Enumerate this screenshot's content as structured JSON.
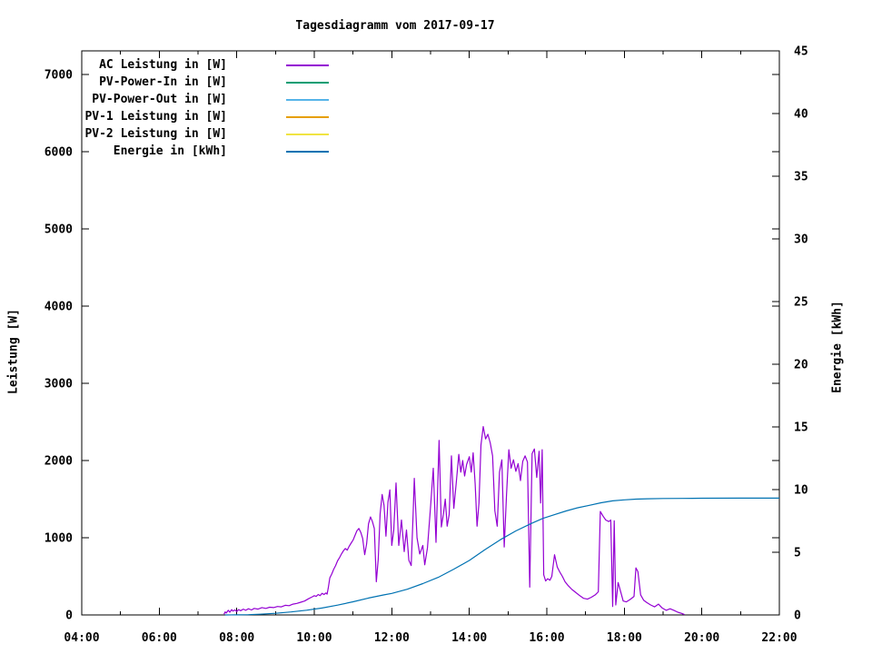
{
  "chart_data": {
    "type": "line",
    "title": "Tagesdiagramm vom 2017-09-17",
    "background_color": "#ffffff",
    "axis_color": "#000000",
    "grid": false,
    "legend_position": "top-left-inside",
    "x_axis": {
      "unit": "time-of-day",
      "range_hours": [
        4,
        22
      ],
      "tick_hours": [
        4,
        6,
        8,
        10,
        12,
        14,
        16,
        18,
        20,
        22
      ],
      "tick_labels": [
        "04:00",
        "06:00",
        "08:00",
        "10:00",
        "12:00",
        "14:00",
        "16:00",
        "18:00",
        "20:00",
        "22:00"
      ],
      "minor_tick_hours": [
        5,
        7,
        9,
        11,
        13,
        15,
        17,
        19,
        21
      ]
    },
    "y_left_axis": {
      "label": "Leistung [W]",
      "range": [
        0,
        7306
      ],
      "ticks": [
        0,
        1000,
        2000,
        3000,
        4000,
        5000,
        6000,
        7000
      ]
    },
    "y_right_axis": {
      "label": "Energie [kWh]",
      "range": [
        0,
        45
      ],
      "ticks": [
        0,
        5,
        10,
        15,
        20,
        25,
        30,
        35,
        40,
        45
      ]
    },
    "series": [
      {
        "name": "AC Leistung in [W]",
        "color": "#9400d3",
        "axis": "left",
        "points": [
          [
            7.67,
            10
          ],
          [
            7.7,
            40
          ],
          [
            7.73,
            25
          ],
          [
            7.78,
            60
          ],
          [
            7.82,
            35
          ],
          [
            7.87,
            70
          ],
          [
            7.9,
            50
          ],
          [
            7.95,
            65
          ],
          [
            8.0,
            45
          ],
          [
            8.05,
            70
          ],
          [
            8.1,
            55
          ],
          [
            8.17,
            75
          ],
          [
            8.23,
            60
          ],
          [
            8.3,
            80
          ],
          [
            8.38,
            65
          ],
          [
            8.45,
            85
          ],
          [
            8.55,
            75
          ],
          [
            8.65,
            95
          ],
          [
            8.75,
            85
          ],
          [
            8.85,
            100
          ],
          [
            8.95,
            95
          ],
          [
            9.05,
            110
          ],
          [
            9.15,
            105
          ],
          [
            9.25,
            125
          ],
          [
            9.35,
            120
          ],
          [
            9.45,
            140
          ],
          [
            9.55,
            150
          ],
          [
            9.65,
            165
          ],
          [
            9.75,
            180
          ],
          [
            9.85,
            210
          ],
          [
            9.95,
            235
          ],
          [
            10.0,
            250
          ],
          [
            10.05,
            240
          ],
          [
            10.1,
            265
          ],
          [
            10.15,
            250
          ],
          [
            10.2,
            280
          ],
          [
            10.25,
            265
          ],
          [
            10.3,
            285
          ],
          [
            10.33,
            270
          ],
          [
            10.36,
            350
          ],
          [
            10.4,
            480
          ],
          [
            10.45,
            530
          ],
          [
            10.5,
            590
          ],
          [
            10.55,
            640
          ],
          [
            10.6,
            700
          ],
          [
            10.65,
            740
          ],
          [
            10.7,
            790
          ],
          [
            10.75,
            830
          ],
          [
            10.8,
            860
          ],
          [
            10.85,
            840
          ],
          [
            10.9,
            890
          ],
          [
            10.95,
            930
          ],
          [
            11.0,
            970
          ],
          [
            11.05,
            1030
          ],
          [
            11.1,
            1090
          ],
          [
            11.15,
            1120
          ],
          [
            11.2,
            1070
          ],
          [
            11.25,
            990
          ],
          [
            11.3,
            780
          ],
          [
            11.35,
            920
          ],
          [
            11.4,
            1180
          ],
          [
            11.45,
            1270
          ],
          [
            11.5,
            1210
          ],
          [
            11.55,
            1120
          ],
          [
            11.6,
            430
          ],
          [
            11.65,
            720
          ],
          [
            11.7,
            1310
          ],
          [
            11.75,
            1560
          ],
          [
            11.8,
            1420
          ],
          [
            11.85,
            1020
          ],
          [
            11.9,
            1460
          ],
          [
            11.95,
            1620
          ],
          [
            12.0,
            900
          ],
          [
            12.05,
            1100
          ],
          [
            12.11,
            1710
          ],
          [
            12.18,
            900
          ],
          [
            12.25,
            1230
          ],
          [
            12.32,
            820
          ],
          [
            12.38,
            1100
          ],
          [
            12.44,
            710
          ],
          [
            12.5,
            640
          ],
          [
            12.55,
            1300
          ],
          [
            12.58,
            1770
          ],
          [
            12.65,
            1000
          ],
          [
            12.72,
            790
          ],
          [
            12.8,
            900
          ],
          [
            12.85,
            650
          ],
          [
            12.92,
            870
          ],
          [
            13.0,
            1400
          ],
          [
            13.07,
            1900
          ],
          [
            13.14,
            940
          ],
          [
            13.18,
            1600
          ],
          [
            13.22,
            2260
          ],
          [
            13.28,
            1140
          ],
          [
            13.33,
            1300
          ],
          [
            13.38,
            1500
          ],
          [
            13.43,
            1150
          ],
          [
            13.48,
            1300
          ],
          [
            13.54,
            2060
          ],
          [
            13.6,
            1380
          ],
          [
            13.66,
            1700
          ],
          [
            13.73,
            2080
          ],
          [
            13.78,
            1850
          ],
          [
            13.83,
            2000
          ],
          [
            13.88,
            1800
          ],
          [
            13.93,
            1950
          ],
          [
            14.0,
            2050
          ],
          [
            14.05,
            1850
          ],
          [
            14.1,
            2100
          ],
          [
            14.15,
            1700
          ],
          [
            14.2,
            1150
          ],
          [
            14.25,
            1450
          ],
          [
            14.3,
            2200
          ],
          [
            14.36,
            2440
          ],
          [
            14.42,
            2280
          ],
          [
            14.48,
            2340
          ],
          [
            14.54,
            2230
          ],
          [
            14.6,
            2060
          ],
          [
            14.66,
            1350
          ],
          [
            14.72,
            1150
          ],
          [
            14.78,
            1850
          ],
          [
            14.84,
            2010
          ],
          [
            14.9,
            880
          ],
          [
            14.96,
            1550
          ],
          [
            15.02,
            2140
          ],
          [
            15.08,
            1900
          ],
          [
            15.14,
            2010
          ],
          [
            15.2,
            1860
          ],
          [
            15.26,
            1960
          ],
          [
            15.32,
            1740
          ],
          [
            15.38,
            1990
          ],
          [
            15.44,
            2060
          ],
          [
            15.5,
            1980
          ],
          [
            15.56,
            360
          ],
          [
            15.62,
            2090
          ],
          [
            15.68,
            2150
          ],
          [
            15.74,
            1780
          ],
          [
            15.8,
            2120
          ],
          [
            15.84,
            1450
          ],
          [
            15.88,
            2140
          ],
          [
            15.92,
            520
          ],
          [
            15.97,
            440
          ],
          [
            16.02,
            470
          ],
          [
            16.08,
            450
          ],
          [
            16.13,
            500
          ],
          [
            16.2,
            780
          ],
          [
            16.27,
            620
          ],
          [
            16.33,
            560
          ],
          [
            16.4,
            500
          ],
          [
            16.47,
            430
          ],
          [
            16.55,
            380
          ],
          [
            16.65,
            330
          ],
          [
            16.75,
            290
          ],
          [
            16.85,
            250
          ],
          [
            16.95,
            215
          ],
          [
            17.05,
            205
          ],
          [
            17.15,
            230
          ],
          [
            17.25,
            260
          ],
          [
            17.33,
            300
          ],
          [
            17.38,
            1340
          ],
          [
            17.45,
            1280
          ],
          [
            17.52,
            1230
          ],
          [
            17.6,
            1210
          ],
          [
            17.65,
            1230
          ],
          [
            17.7,
            110
          ],
          [
            17.74,
            1220
          ],
          [
            17.78,
            130
          ],
          [
            17.84,
            420
          ],
          [
            17.9,
            310
          ],
          [
            17.97,
            180
          ],
          [
            18.05,
            170
          ],
          [
            18.15,
            200
          ],
          [
            18.25,
            240
          ],
          [
            18.3,
            610
          ],
          [
            18.35,
            560
          ],
          [
            18.42,
            260
          ],
          [
            18.5,
            190
          ],
          [
            18.58,
            160
          ],
          [
            18.68,
            130
          ],
          [
            18.78,
            105
          ],
          [
            18.88,
            140
          ],
          [
            18.98,
            90
          ],
          [
            19.08,
            60
          ],
          [
            19.18,
            80
          ],
          [
            19.28,
            60
          ],
          [
            19.38,
            35
          ],
          [
            19.48,
            20
          ],
          [
            19.55,
            5
          ]
        ]
      },
      {
        "name": "PV-Power-In in [W]",
        "color": "#009e73",
        "axis": "left",
        "points": []
      },
      {
        "name": "PV-Power-Out in [W]",
        "color": "#56b4e9",
        "axis": "left",
        "points": []
      },
      {
        "name": "PV-1 Leistung in [W]",
        "color": "#e69f00",
        "axis": "left",
        "points": []
      },
      {
        "name": "PV-2 Leistung in [W]",
        "color": "#f0e442",
        "axis": "left",
        "points": []
      },
      {
        "name": "Energie in [kWh]",
        "color": "#0072b2",
        "axis": "right",
        "points": [
          [
            7.7,
            0
          ],
          [
            8.0,
            0.01
          ],
          [
            8.3,
            0.02
          ],
          [
            8.6,
            0.06
          ],
          [
            9.0,
            0.13
          ],
          [
            9.4,
            0.24
          ],
          [
            9.8,
            0.38
          ],
          [
            10.2,
            0.55
          ],
          [
            10.6,
            0.78
          ],
          [
            11.0,
            1.05
          ],
          [
            11.4,
            1.35
          ],
          [
            11.8,
            1.6
          ],
          [
            12.0,
            1.72
          ],
          [
            12.4,
            2.05
          ],
          [
            12.8,
            2.5
          ],
          [
            13.2,
            3.0
          ],
          [
            13.6,
            3.65
          ],
          [
            14.0,
            4.35
          ],
          [
            14.4,
            5.2
          ],
          [
            14.8,
            6.0
          ],
          [
            15.2,
            6.7
          ],
          [
            15.6,
            7.3
          ],
          [
            15.9,
            7.7
          ],
          [
            16.2,
            8.0
          ],
          [
            16.5,
            8.3
          ],
          [
            16.8,
            8.55
          ],
          [
            17.1,
            8.75
          ],
          [
            17.4,
            8.95
          ],
          [
            17.7,
            9.1
          ],
          [
            18.0,
            9.18
          ],
          [
            18.3,
            9.24
          ],
          [
            18.6,
            9.27
          ],
          [
            19.0,
            9.29
          ],
          [
            19.5,
            9.3
          ],
          [
            20.0,
            9.31
          ],
          [
            21.0,
            9.32
          ],
          [
            22.0,
            9.32
          ]
        ]
      }
    ]
  }
}
